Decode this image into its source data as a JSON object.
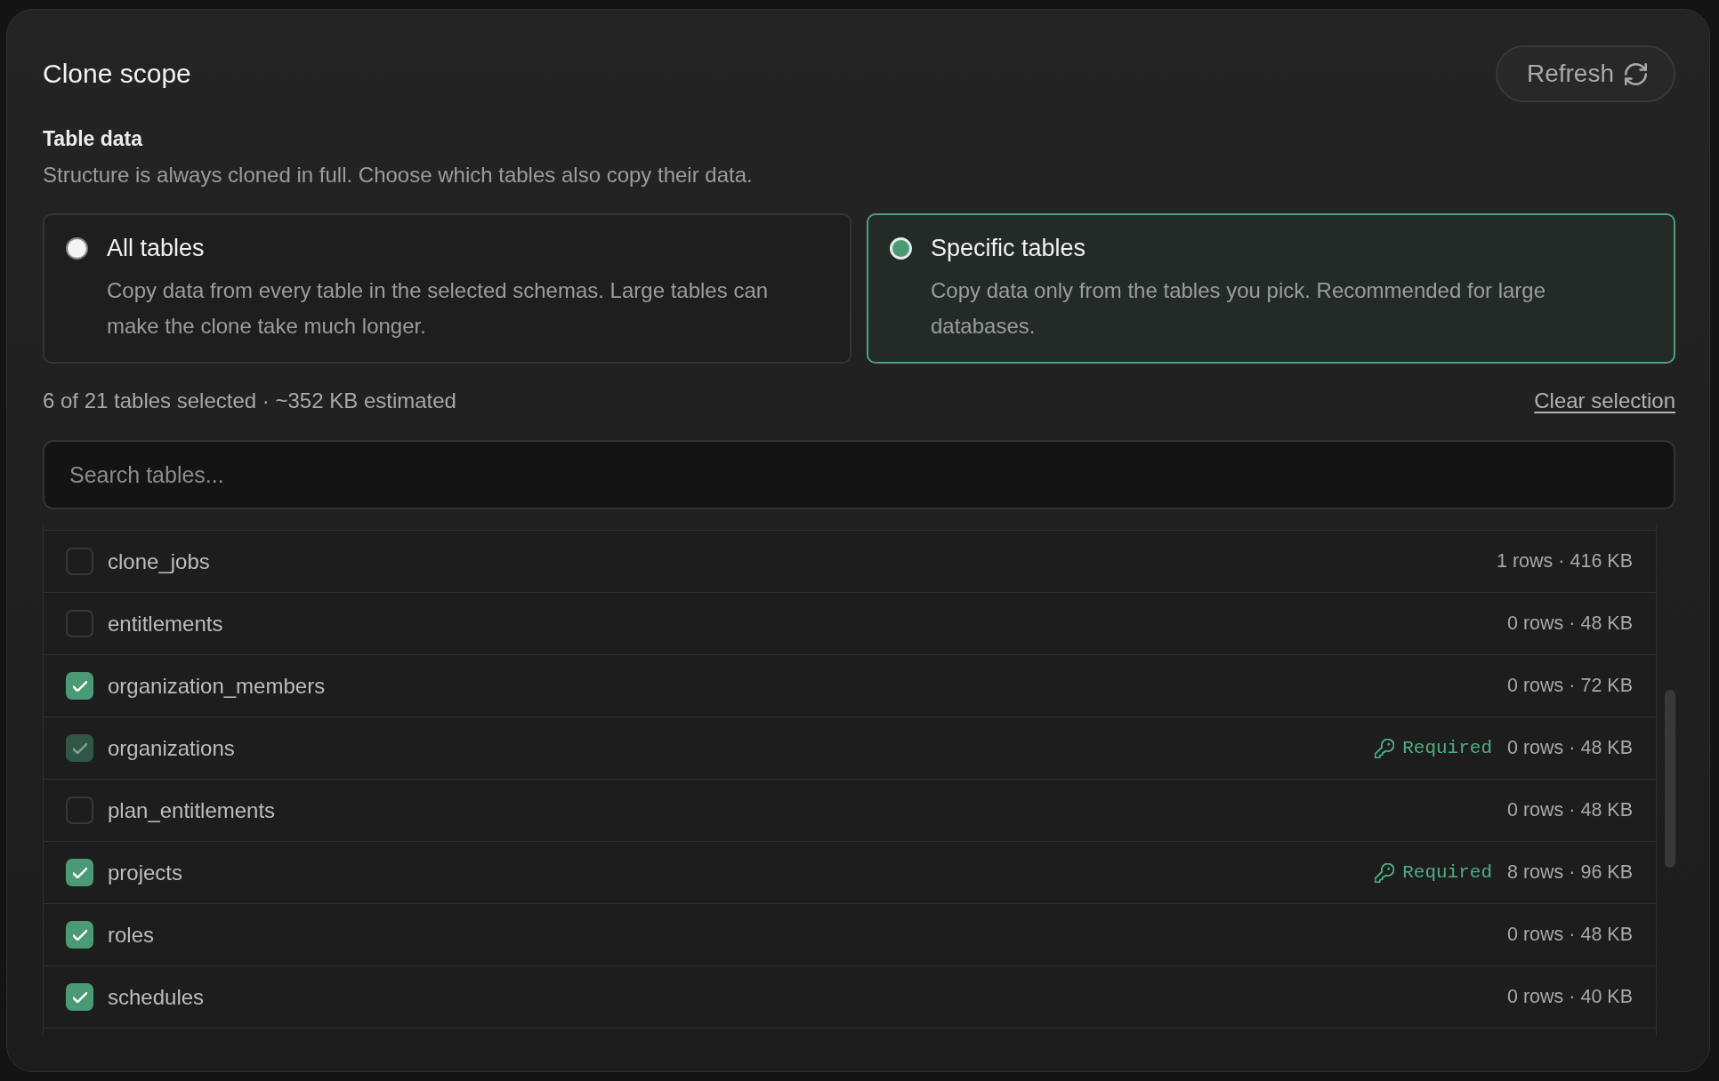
{
  "header": {
    "title": "Clone scope",
    "refresh_button": {
      "label": "Refresh"
    }
  },
  "table_data": {
    "heading": "Table data",
    "description": "Structure is always cloned in full. Choose which tables also copy their data."
  },
  "options": [
    {
      "title": "All tables",
      "description": "Copy data from every table in the selected schemas. Large tables can make the clone take much longer.",
      "selected": false
    },
    {
      "title": "Specific tables",
      "description": "Copy data only from the tables you pick. Recommended for large databases.",
      "selected": true
    }
  ],
  "summary": "6 of 21 tables selected · ~352 KB estimated",
  "clear_selection": "Clear selection",
  "search": {
    "placeholder": "Search tables..."
  },
  "tables": [
    {
      "name": "clone_jobs",
      "checked": false,
      "disabled": false,
      "stats": "1 rows · 416 KB"
    },
    {
      "name": "entitlements",
      "checked": false,
      "disabled": false,
      "stats": "0 rows · 48 KB"
    },
    {
      "name": "organization_members",
      "checked": true,
      "disabled": false,
      "stats": "0 rows · 72 KB"
    },
    {
      "name": "organizations",
      "checked": true,
      "disabled": true,
      "badge": "Required",
      "stats": "0 rows · 48 KB"
    },
    {
      "name": "plan_entitlements",
      "checked": false,
      "disabled": false,
      "stats": "0 rows · 48 KB"
    },
    {
      "name": "projects",
      "checked": true,
      "disabled": false,
      "badge": "Required",
      "stats": "8 rows · 96 KB"
    },
    {
      "name": "roles",
      "checked": true,
      "disabled": false,
      "stats": "0 rows · 48 KB"
    },
    {
      "name": "schedules",
      "checked": true,
      "disabled": false,
      "stats": "0 rows · 40 KB"
    }
  ]
}
